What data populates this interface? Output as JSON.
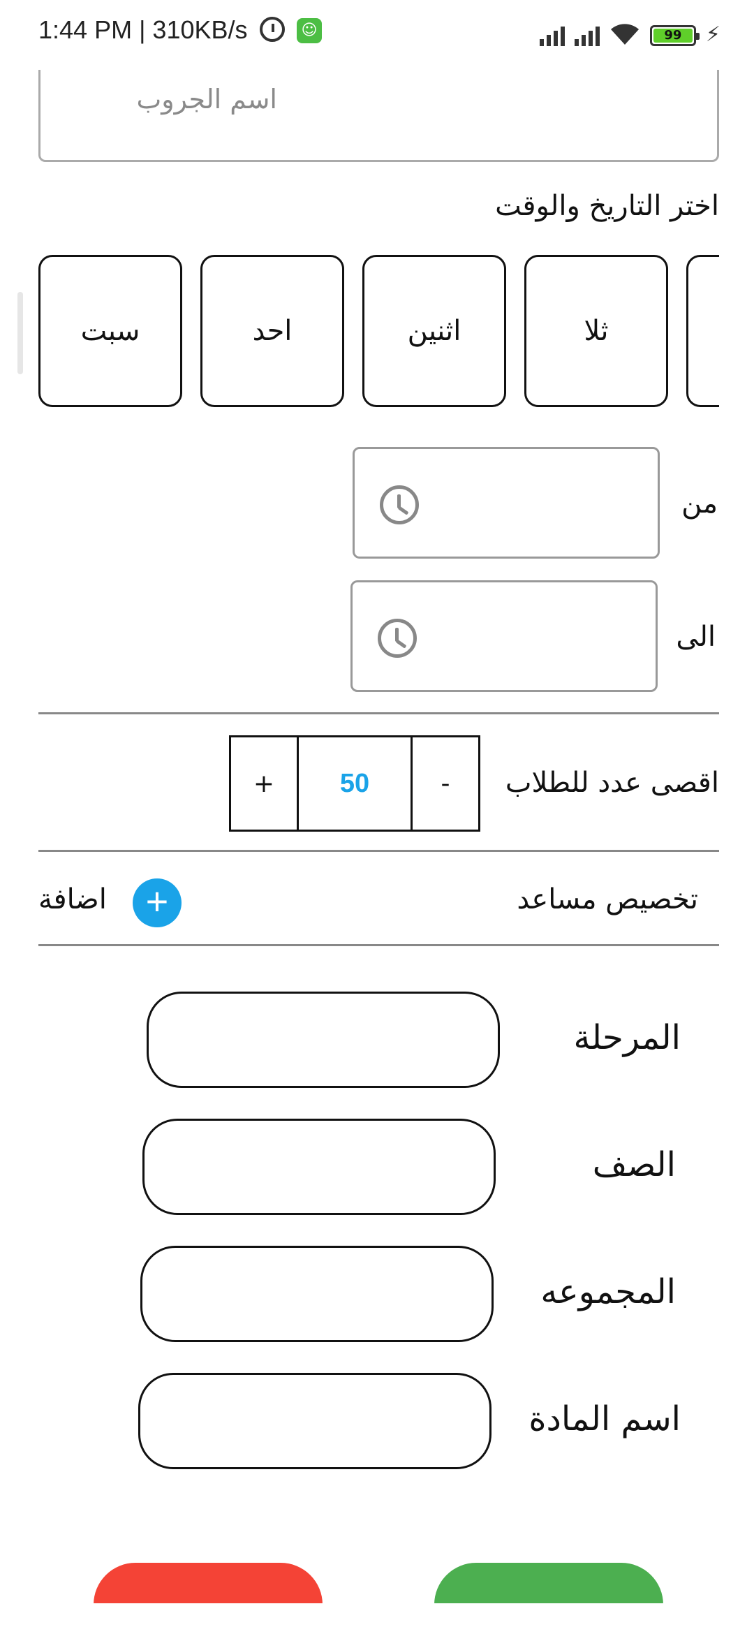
{
  "status_bar": {
    "time": "1:44 PM | 310KB/s",
    "battery": "99"
  },
  "form": {
    "group_name_placeholder": "اسم الجروب",
    "date_time_label": "اختر التاريخ والوقت",
    "days": [
      "سبت",
      "احد",
      "اثنين",
      "ثلا"
    ],
    "from_label": "من",
    "to_label": "الى",
    "max_students_label": "اقصى عدد للطلاب",
    "stepper": {
      "plus": "+",
      "value": "50",
      "minus": "-"
    },
    "assistant_label": "تخصيص مساعد",
    "add_label": "اضافة",
    "fields": {
      "stage": "المرحلة",
      "grade": "الصف",
      "group": "المجموعه",
      "subject": "اسم المادة"
    }
  },
  "colors": {
    "accent": "#1aa3e8",
    "cancel": "#f44336",
    "confirm": "#4caf50"
  }
}
